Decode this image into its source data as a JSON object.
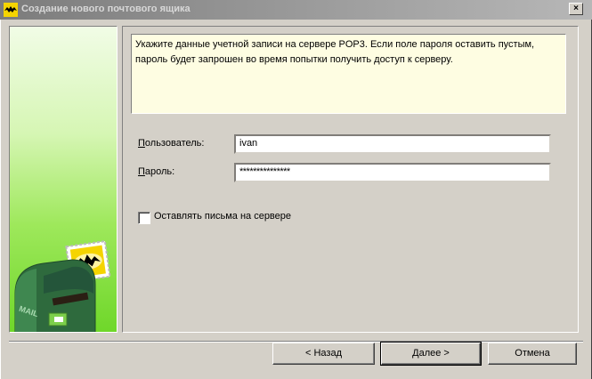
{
  "window": {
    "title": "Создание нового почтового ящика",
    "close_glyph": "×"
  },
  "info_text": "Укажите данные учетной записи на сервере POP3. Если поле пароля оставить пустым, пароль будет запрошен во время попытки получить доступ к серверу.",
  "form": {
    "username_label_accel": "П",
    "username_label_rest": "ользователь:",
    "username_value": "ivan",
    "password_label_accel": "П",
    "password_label_rest": "ароль:",
    "password_value": "***************",
    "leave_on_server_label": "Оставлять письма на сервере",
    "leave_on_server_checked": false
  },
  "buttons": {
    "back": "< Назад",
    "next": "Далее >",
    "cancel": "Отмена"
  },
  "illustration": {
    "mailbox_text": "MAIL",
    "icon": "bat-mailbox-icon",
    "colors": {
      "green_top": "#f1fce6",
      "green_bottom": "#6fd72a",
      "mailbox": "#2e6a3d",
      "stamp_yellow": "#f5d400"
    }
  }
}
